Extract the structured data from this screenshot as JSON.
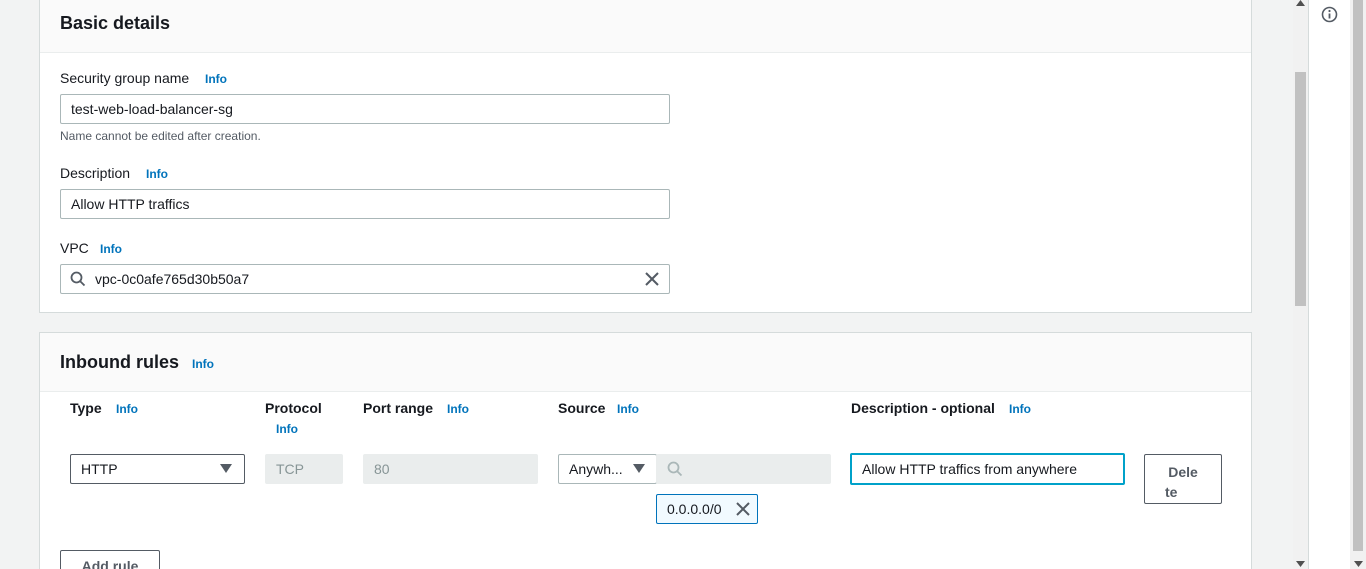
{
  "basic": {
    "title": "Basic details",
    "sg_name_label": "Security group name",
    "sg_name_info": "Info",
    "sg_name_value": "test-web-load-balancer-sg",
    "sg_name_hint": "Name cannot be edited after creation.",
    "description_label": "Description",
    "description_info": "Info",
    "description_value": "Allow HTTP traffics",
    "vpc_label": "VPC",
    "vpc_info": "Info",
    "vpc_value": "vpc-0c0afe765d30b50a7"
  },
  "inbound": {
    "title": "Inbound rules",
    "title_info": "Info",
    "columns": {
      "type": "Type",
      "type_info": "Info",
      "protocol": "Protocol",
      "protocol_info": "Info",
      "port_range": "Port range",
      "port_range_info": "Info",
      "source": "Source",
      "source_info": "Info",
      "description": "Description - optional",
      "description_info": "Info"
    },
    "rule": {
      "type": "HTTP",
      "protocol": "TCP",
      "port_range": "80",
      "source": "Anywh...",
      "source_search": "",
      "cidr_tag": "0.0.0.0/0",
      "description": "Allow HTTP traffics from anywhere",
      "delete_line1": "Dele",
      "delete_line2": "te"
    },
    "add_rule_label": "Add rule"
  },
  "colors": {
    "link": "#0073bb",
    "focus_border": "#00a1c9",
    "panel_header_bg": "#fafafa",
    "page_bg": "#f2f3f3"
  },
  "icons": [
    "search-icon",
    "close-icon",
    "caret-down-icon",
    "info-circle-icon"
  ]
}
